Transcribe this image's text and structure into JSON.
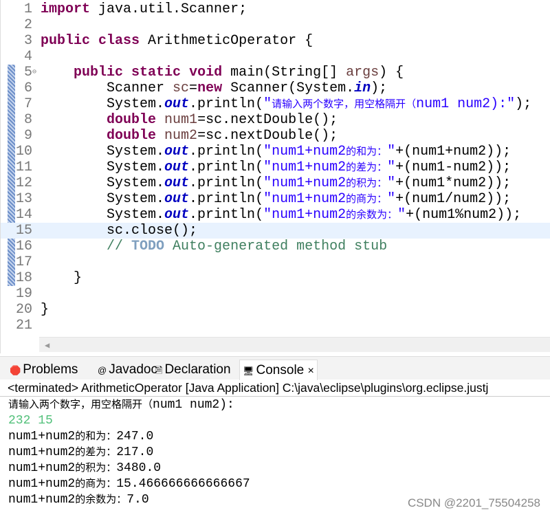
{
  "editor": {
    "lines": [
      {
        "n": "1",
        "parts": [
          [
            "kw",
            "import"
          ],
          [
            "",
            "java.util.Scanner;"
          ]
        ],
        "sep": [
          " "
        ]
      },
      {
        "n": "2",
        "parts": []
      },
      {
        "n": "3",
        "parts": [
          [
            "kw",
            "public"
          ],
          [
            "",
            " "
          ],
          [
            "kw",
            "class"
          ],
          [
            "",
            " ArithmeticOperator {"
          ]
        ]
      },
      {
        "n": "4",
        "parts": []
      },
      {
        "n": "5",
        "fold": true,
        "parts": [
          [
            "",
            "    "
          ],
          [
            "kw",
            "public"
          ],
          [
            "",
            " "
          ],
          [
            "kw",
            "static"
          ],
          [
            "",
            " "
          ],
          [
            "kw",
            "void"
          ],
          [
            "",
            " main(String[] "
          ],
          [
            "var",
            "args"
          ],
          [
            "",
            ") {"
          ]
        ]
      },
      {
        "n": "6",
        "parts": [
          [
            "",
            "        Scanner "
          ],
          [
            "var",
            "sc"
          ],
          [
            "",
            "="
          ],
          [
            "kw",
            "new"
          ],
          [
            "",
            " Scanner(System."
          ],
          [
            "fld",
            "in"
          ],
          [
            "",
            ");"
          ]
        ]
      },
      {
        "n": "7",
        "parts": [
          [
            "",
            "        System."
          ],
          [
            "fld",
            "out"
          ],
          [
            "",
            ".println("
          ],
          [
            "str",
            "\"请输入两个数字，用空格隔开（num1 num2):\""
          ],
          [
            "",
            ");"
          ]
        ]
      },
      {
        "n": "8",
        "parts": [
          [
            "",
            "        "
          ],
          [
            "kw",
            "double"
          ],
          [
            "",
            " "
          ],
          [
            "var",
            "num1"
          ],
          [
            "",
            "=sc.nextDouble();"
          ]
        ]
      },
      {
        "n": "9",
        "parts": [
          [
            "",
            "        "
          ],
          [
            "kw",
            "double"
          ],
          [
            "",
            " "
          ],
          [
            "var",
            "num2"
          ],
          [
            "",
            "=sc.nextDouble();"
          ]
        ]
      },
      {
        "n": "10",
        "parts": [
          [
            "",
            "        System."
          ],
          [
            "fld",
            "out"
          ],
          [
            "",
            ".println("
          ],
          [
            "str",
            "\"num1+num2的和为：\""
          ],
          [
            "",
            "+(num1+num2));"
          ]
        ]
      },
      {
        "n": "11",
        "parts": [
          [
            "",
            "        System."
          ],
          [
            "fld",
            "out"
          ],
          [
            "",
            ".println("
          ],
          [
            "str",
            "\"num1+num2的差为：\""
          ],
          [
            "",
            "+(num1-num2));"
          ]
        ]
      },
      {
        "n": "12",
        "parts": [
          [
            "",
            "        System."
          ],
          [
            "fld",
            "out"
          ],
          [
            "",
            ".println("
          ],
          [
            "str",
            "\"num1+num2的积为：\""
          ],
          [
            "",
            "+(num1*num2));"
          ]
        ]
      },
      {
        "n": "13",
        "parts": [
          [
            "",
            "        System."
          ],
          [
            "fld",
            "out"
          ],
          [
            "",
            ".println("
          ],
          [
            "str",
            "\"num1+num2的商为：\""
          ],
          [
            "",
            "+(num1/num2));"
          ]
        ]
      },
      {
        "n": "14",
        "parts": [
          [
            "",
            "        System."
          ],
          [
            "fld",
            "out"
          ],
          [
            "",
            ".println("
          ],
          [
            "str",
            "\"num1+num2的余数为：\""
          ],
          [
            "",
            "+(num1%num2));"
          ]
        ]
      },
      {
        "n": "15",
        "current": true,
        "parts": [
          [
            "",
            "        sc.close();"
          ]
        ]
      },
      {
        "n": "16",
        "parts": [
          [
            "",
            "        "
          ],
          [
            "cmt",
            "// "
          ],
          [
            "todo",
            "TODO"
          ],
          [
            "cmt",
            " Auto-generated method stub"
          ]
        ]
      },
      {
        "n": "17",
        "parts": []
      },
      {
        "n": "18",
        "parts": [
          [
            "",
            "    }"
          ]
        ]
      },
      {
        "n": "19",
        "parts": []
      },
      {
        "n": "20",
        "parts": [
          [
            "",
            "}"
          ]
        ]
      },
      {
        "n": "21",
        "parts": []
      }
    ]
  },
  "tabs": [
    {
      "label": "Problems",
      "icon": "problems-icon"
    },
    {
      "label": "Javadoc",
      "icon": "javadoc-icon"
    },
    {
      "label": "Declaration",
      "icon": "declaration-icon"
    },
    {
      "label": "Console",
      "icon": "console-icon",
      "active": true,
      "close": "×"
    }
  ],
  "console": {
    "status": "<terminated> ArithmeticOperator [Java Application] C:\\java\\eclipse\\plugins\\org.eclipse.justj",
    "lines": [
      {
        "zh": "请输入两个数字，用空格隔开（",
        "rest": "num1 num2):"
      },
      {
        "input": "232 15"
      },
      {
        "pre": "num1+num2",
        "zh": "的和为：",
        "rest": "247.0"
      },
      {
        "pre": "num1+num2",
        "zh": "的差为：",
        "rest": "217.0"
      },
      {
        "pre": "num1+num2",
        "zh": "的积为：",
        "rest": "3480.0"
      },
      {
        "pre": "num1+num2",
        "zh": "的商为：",
        "rest": "15.466666666666667"
      },
      {
        "pre": "num1+num2",
        "zh": "的余数为：",
        "rest": "7.0"
      }
    ]
  },
  "watermark": "CSDN @2201_75504258"
}
